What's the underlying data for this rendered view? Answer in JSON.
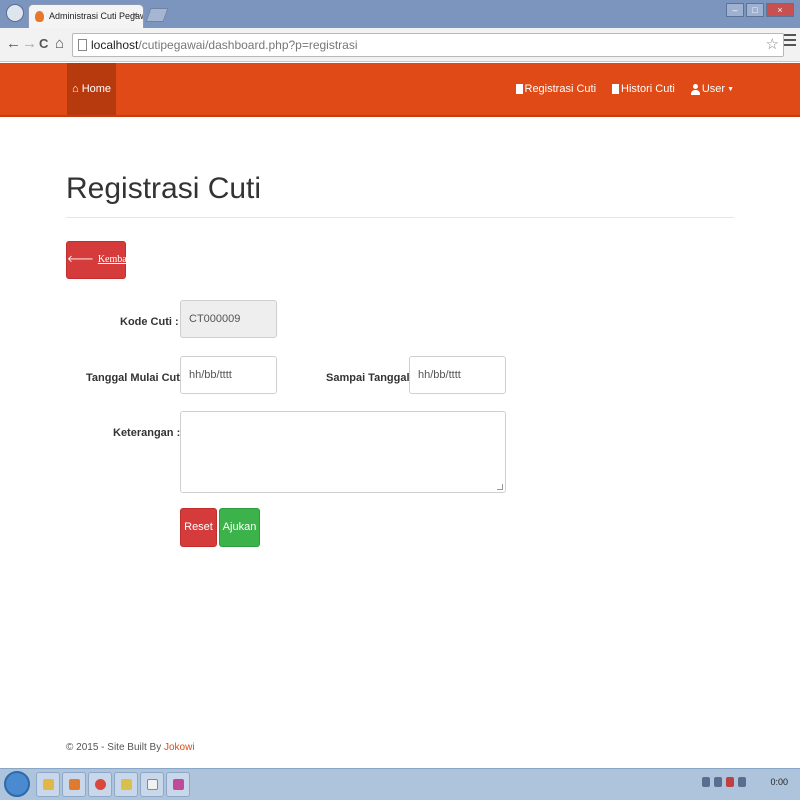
{
  "browser": {
    "tab_title": "Administrasi Cuti Pegawai",
    "tab_close": "×",
    "url_host": "localhost",
    "url_path": "/cutipegawai/dashboard.php?p=registrasi",
    "back_glyph": "←",
    "forward_glyph": "→",
    "reload_glyph": "C",
    "home_glyph": "⌂",
    "star_glyph": "☆",
    "window_min": "–",
    "window_max": "□",
    "window_close": "×"
  },
  "navbar": {
    "home_label": "Home",
    "links": [
      {
        "label": "Registrasi Cuti",
        "icon": "document-icon"
      },
      {
        "label": "Histori Cuti",
        "icon": "document-icon"
      },
      {
        "label": "User",
        "icon": "user-icon"
      }
    ],
    "brand_color": "#df4a16"
  },
  "page": {
    "title": "Registrasi Cuti",
    "back_button": "Kembali",
    "back_arrow": "🡐"
  },
  "form": {
    "kode_label": "Kode Cuti :",
    "kode_value": "CT000009",
    "start_label": "Tanggal Mulai Cuti :",
    "start_placeholder": "hh/bb/tttt",
    "end_label": "Sampai Tanggal :",
    "end_placeholder": "hh/bb/tttt",
    "note_label": "Keterangan :",
    "note_value": "",
    "reset_button": "Reset",
    "submit_button": "Ajukan"
  },
  "footer": {
    "text": "© 2015 - Site Built By",
    "author": "Jokowi"
  },
  "taskbar": {
    "clock": "0:00"
  }
}
